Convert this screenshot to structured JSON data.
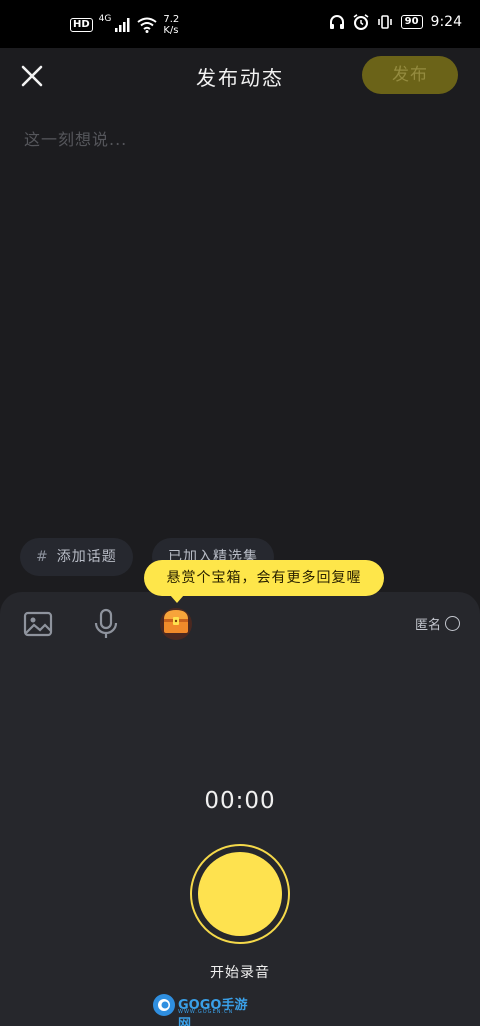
{
  "status_bar": {
    "hd": "HD",
    "network": "4G",
    "speed_value": "7.2",
    "speed_unit": "K/s",
    "battery": "90",
    "time": "9:24"
  },
  "nav": {
    "title": "发布动态",
    "publish_label": "发布"
  },
  "composer": {
    "placeholder": "这一刻想说..."
  },
  "chips": {
    "topic_hash": "#",
    "topic_label": "添加话题",
    "collection_label": "已加入精选集"
  },
  "tooltip": {
    "text": "悬赏个宝箱，会有更多回复喔"
  },
  "toolbar": {
    "anonymous_label": "匿名"
  },
  "recorder": {
    "timer": "00:00",
    "record_label": "开始录音"
  },
  "watermark": {
    "brand": "GOGO手游网",
    "sub": "WWW.GOGEN.CN"
  },
  "colors": {
    "accent": "#fee24f",
    "publish_disabled_bg": "#6b6318",
    "background": "#1c1c1f",
    "panel": "#26272c"
  }
}
